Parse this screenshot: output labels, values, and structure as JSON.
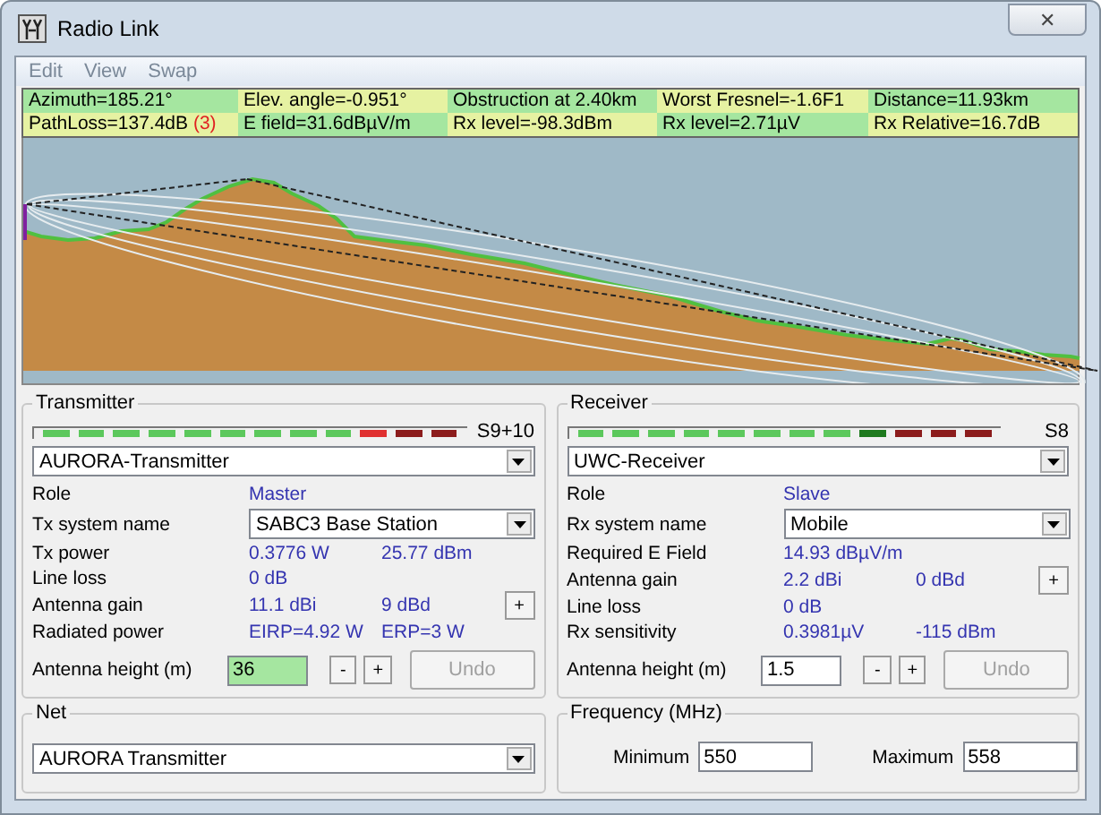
{
  "window": {
    "title": "Radio Link",
    "close": "✕"
  },
  "menu": [
    "Edit",
    "View",
    "Swap"
  ],
  "info_rows": [
    [
      {
        "text": "Azimuth=185.21°"
      },
      {
        "text": "Elev. angle=-0.951°"
      },
      {
        "text": "Obstruction at 2.40km"
      },
      {
        "text": "Worst Fresnel=-1.6F1"
      },
      {
        "text": "Distance=11.93km"
      }
    ],
    [
      {
        "text": "PathLoss=137.4dB",
        "note": "(3)"
      },
      {
        "text": "E field=31.6dBµV/m"
      },
      {
        "text": "Rx level=-98.3dBm"
      },
      {
        "text": "Rx level=2.71µV"
      },
      {
        "text": "Rx Relative=16.7dB"
      }
    ]
  ],
  "panels": [
    {
      "title": "Transmitter",
      "meter_reading": "S9+10",
      "meter_segments": [
        {
          "color": "#5cc85c"
        },
        {
          "color": "#5cc85c"
        },
        {
          "color": "#5cc85c"
        },
        {
          "color": "#5cc85c"
        },
        {
          "color": "#5cc85c"
        },
        {
          "color": "#5cc85c"
        },
        {
          "color": "#5cc85c"
        },
        {
          "color": "#5cc85c"
        },
        {
          "color": "#5cc85c"
        },
        {
          "color": "#e03030"
        },
        {
          "color": "#8c1c1c"
        },
        {
          "color": "#8c1c1c"
        }
      ],
      "station": "AURORA-Transmitter",
      "rows": [
        {
          "kind": "values",
          "label": "Role",
          "values": [
            "Master"
          ]
        },
        {
          "kind": "select",
          "label": "Tx system name",
          "value": "SABC3 Base Station"
        },
        {
          "kind": "values",
          "label": "Tx power",
          "values": [
            "0.3776 W",
            "25.77 dBm"
          ]
        },
        {
          "kind": "values",
          "label": "Line loss",
          "values": [
            "0 dB"
          ]
        },
        {
          "kind": "values",
          "label": "Antenna gain",
          "values": [
            "11.1 dBi",
            "9 dBd"
          ],
          "button": "+"
        },
        {
          "kind": "values",
          "label": "Radiated power",
          "values": [
            "EIRP=4.92 W",
            "ERP=3 W"
          ]
        }
      ],
      "height": {
        "label": "Antenna height (m)",
        "value": "36",
        "modified": true,
        "minus": "-",
        "plus": "+",
        "undo": "Undo",
        "undo_disabled": true
      }
    },
    {
      "title": "Receiver",
      "meter_reading": "S8",
      "meter_segments": [
        {
          "color": "#5cc85c"
        },
        {
          "color": "#5cc85c"
        },
        {
          "color": "#5cc85c"
        },
        {
          "color": "#5cc85c"
        },
        {
          "color": "#5cc85c"
        },
        {
          "color": "#5cc85c"
        },
        {
          "color": "#5cc85c"
        },
        {
          "color": "#5cc85c"
        },
        {
          "color": "#1e7a1e"
        },
        {
          "color": "#8c1c1c"
        },
        {
          "color": "#8c1c1c"
        },
        {
          "color": "#8c1c1c"
        }
      ],
      "station": "UWC-Receiver",
      "rows": [
        {
          "kind": "values",
          "label": "Role",
          "values": [
            "Slave"
          ]
        },
        {
          "kind": "select",
          "label": "Rx system name",
          "value": "Mobile"
        },
        {
          "kind": "values",
          "label": "Required E Field",
          "values": [
            "14.93 dBµV/m"
          ]
        },
        {
          "kind": "values",
          "label": "Antenna gain",
          "values": [
            "2.2 dBi",
            "0 dBd"
          ],
          "button": "+"
        },
        {
          "kind": "values",
          "label": "Line loss",
          "values": [
            "0 dB"
          ]
        },
        {
          "kind": "values",
          "label": "Rx sensitivity",
          "values": [
            "0.3981µV",
            "-115 dBm"
          ]
        }
      ],
      "height": {
        "label": "Antenna height (m)",
        "value": "1.5",
        "modified": false,
        "minus": "-",
        "plus": "+",
        "undo": "Undo",
        "undo_disabled": true
      }
    }
  ],
  "net": {
    "title": "Net",
    "value": "AURORA Transmitter"
  },
  "frequency": {
    "title": "Frequency (MHz)",
    "minimum_label": "Minimum",
    "minimum": "550",
    "maximum_label": "Maximum",
    "maximum": "558"
  }
}
